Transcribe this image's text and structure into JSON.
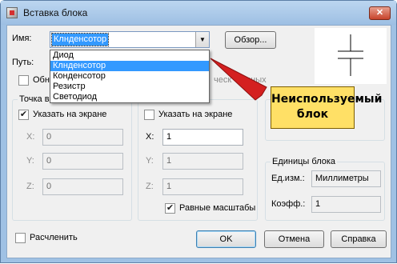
{
  "window": {
    "title": "Вставка блока",
    "close_glyph": "✕"
  },
  "name_field": {
    "label": "Имя:",
    "value": "Клнденсотор",
    "browse_button": "Обзор...",
    "dropdown_options": [
      "Диод",
      "Клнденсотор",
      "Конденсотор",
      "Резистр",
      "Светодиод"
    ],
    "selected_option": "Клнденсотор"
  },
  "path": {
    "label": "Путь:"
  },
  "partial_labels": {
    "geo_checkbox": "Обн",
    "geo_text": "ческ",
    "geo_text2": "анных"
  },
  "insertion_point": {
    "group_label": "Точка в",
    "specify_on_screen": "Указать на экране",
    "specify_checked": true,
    "x_label": "X:",
    "x_value": "0",
    "y_label": "Y:",
    "y_value": "0",
    "z_label": "Z:",
    "z_value": "0"
  },
  "scale": {
    "specify_on_screen": "Указать на экране",
    "specify_checked": false,
    "x_label": "X:",
    "x_value": "1",
    "y_label": "Y:",
    "y_value": "1",
    "z_label": "Z:",
    "z_value": "1",
    "uniform_scale": "Равные масштабы",
    "uniform_checked": true
  },
  "block_units": {
    "group_label": "Единицы блока",
    "units_label": "Ед.изм.:",
    "units_value": "Миллиметры",
    "factor_label": "Коэфф.:",
    "factor_value": "1"
  },
  "explode": {
    "label": "Расчленить"
  },
  "buttons": {
    "ok": "OK",
    "cancel": "Отмена",
    "help": "Справка"
  },
  "callout": {
    "line1": "Неиспользуемый",
    "line2": "блок"
  },
  "colors": {
    "accent": "#3399ff",
    "callout_fill": "#ffe066",
    "callout_arrow": "#d42020",
    "title_bar": "#9fc1e4"
  }
}
